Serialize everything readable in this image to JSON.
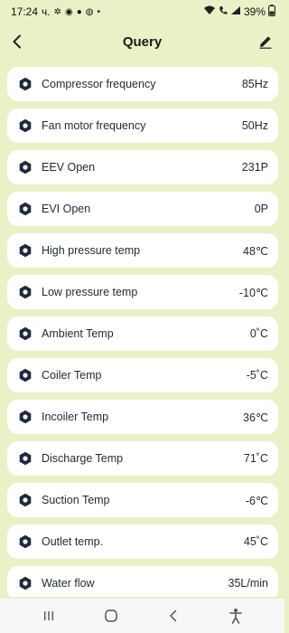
{
  "status": {
    "time": "17:24",
    "suffix": "ч.",
    "battery": "39%"
  },
  "header": {
    "title": "Query",
    "back_icon": "chevron-left-icon",
    "edit_icon": "pencil-icon"
  },
  "colors": {
    "background": "#eaf1c6",
    "card": "#ffffff",
    "icon": "#1f2a3d",
    "text": "#1e2a33"
  },
  "rows": [
    {
      "label": "Compressor frequency",
      "value": "85Hz"
    },
    {
      "label": "Fan motor frequency",
      "value": "50Hz"
    },
    {
      "label": "EEV Open",
      "value": "231P"
    },
    {
      "label": "EVI Open",
      "value": "0P"
    },
    {
      "label": "High pressure temp",
      "value": "48℃"
    },
    {
      "label": "Low pressure temp",
      "value": "-10℃"
    },
    {
      "label": "Ambient Temp",
      "value": "0˚C"
    },
    {
      "label": "Coiler Temp",
      "value": "-5˚C"
    },
    {
      "label": "Incoiler Temp",
      "value": "36℃"
    },
    {
      "label": "Discharge Temp",
      "value": "71˚C"
    },
    {
      "label": "Suction Temp",
      "value": "-6℃"
    },
    {
      "label": "Outlet temp.",
      "value": "45˚C"
    },
    {
      "label": "Water flow",
      "value": "35L/min"
    }
  ]
}
